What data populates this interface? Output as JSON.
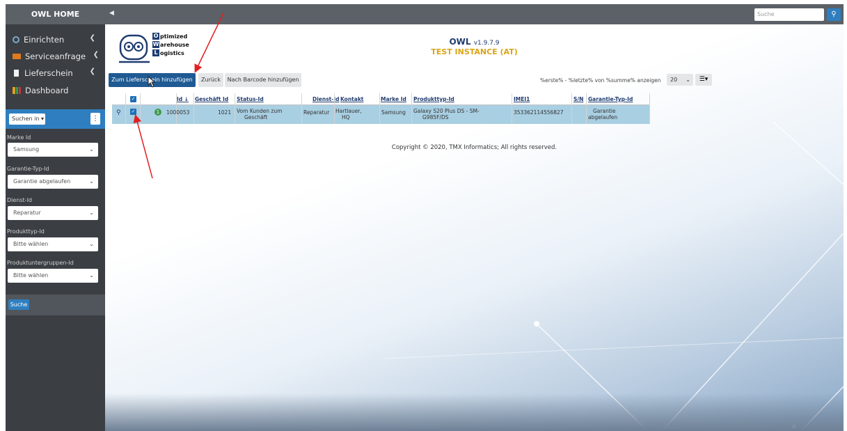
{
  "sidebar": {
    "brand": "OWL HOME",
    "nav": [
      {
        "label": "Einrichten",
        "icon": "gear-icon"
      },
      {
        "label": "Serviceanfrage",
        "icon": "inbox-icon"
      },
      {
        "label": "Lieferschein",
        "icon": "document-icon"
      },
      {
        "label": "Dashboard",
        "icon": "bar-chart-icon"
      }
    ],
    "search_in_label": "Suchen in ▾",
    "filters": [
      {
        "label": "Marke Id",
        "value": "Samsung"
      },
      {
        "label": "Garantie-Typ-Id",
        "value": "Garantie abgelaufen"
      },
      {
        "label": "Dienst-Id",
        "value": "Reparatur"
      },
      {
        "label": "Produkttyp-Id",
        "value": "Bitte wählen"
      },
      {
        "label": "Produktuntergruppen-Id",
        "value": "Bitte wählen"
      }
    ],
    "search_button": "Suche"
  },
  "topbar": {
    "search_placeholder": "Suche"
  },
  "header": {
    "logo_lines": [
      "ptimized",
      "arehouse",
      "ogistics"
    ],
    "logo_letters": [
      "O",
      "W",
      "L"
    ],
    "app_name": "OWL",
    "version": "v1.9.7.9",
    "instance": "TEST INSTANCE (AT)"
  },
  "toolbar": {
    "add_delivery_label": "Zum Lieferschein hinzufügen",
    "back_label": "Zurück",
    "add_barcode_label": "Nach Barcode hinzufügen",
    "paging_text": "%erste% - %letzte% von %summe% anzeigen",
    "page_size": "20"
  },
  "table": {
    "columns": [
      "Id ↓",
      "Geschäft Id",
      "Status-Id",
      "Dienst-Id",
      "Kontakt",
      "Marke Id",
      "Produkttyp-Id",
      "IMEI1",
      "S/N",
      "Garantie-Typ-Id"
    ],
    "rows": [
      {
        "badge": "1",
        "id": "1000053",
        "geschaeft_id": "1021",
        "status_1": "Vom Kunden zum",
        "status_2": "Geschäft",
        "dienst": "Reparatur",
        "kontakt_1": "Hartlauer,",
        "kontakt_2": "HQ",
        "marke": "Samsung",
        "produkt_1": "Galaxy S20 Plus DS - SM-",
        "produkt_2": "G985F/DS",
        "imei": "353362114556827",
        "sn": "",
        "garantie_1": "Garantie",
        "garantie_2": "abgelaufen"
      }
    ]
  },
  "footer": {
    "copyright": "Copyright © 2020, TMX Informatics; All rights reserved."
  },
  "colors": {
    "sidebar_bg": "#3b3f44",
    "topbar_bg": "#5c6168",
    "accent": "#2f7fc0",
    "primary_button": "#1f5a93",
    "selected_row": "#a9cfe2",
    "instance_text": "#d9a516",
    "annotation_arrow": "#e02020"
  }
}
